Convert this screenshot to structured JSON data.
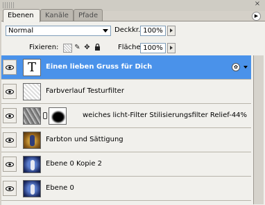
{
  "tabs": [
    {
      "label": "Ebenen",
      "active": true
    },
    {
      "label": "Kanäle",
      "active": false
    },
    {
      "label": "Pfade",
      "active": false
    }
  ],
  "blend_mode": {
    "selected": "Normal"
  },
  "opacity": {
    "label": "Deckkr.:",
    "value": "100%"
  },
  "fill": {
    "label": "Fläche:",
    "value": "100%"
  },
  "lock": {
    "label": "Fixieren:",
    "icons": [
      "lock-transparent-icon",
      "lock-image-icon",
      "lock-position-icon",
      "lock-all-icon"
    ]
  },
  "layers": [
    {
      "name": "Einen lieben Gruss für  Dich",
      "thumb": "text",
      "selected": true,
      "fx": true
    },
    {
      "name": "Farbverlauf Testurfilter",
      "thumb": "transparent",
      "selected": false
    },
    {
      "name": "weiches licht-Filter Stilisierungsfilter Relief-44%",
      "thumb": "relief",
      "mask": true,
      "selected": false
    },
    {
      "name": "Farbton und Sättigung",
      "thumb": "photo-gold",
      "selected": false
    },
    {
      "name": "Ebene 0 Kopie 2",
      "thumb": "photo-blue",
      "selected": false
    },
    {
      "name": "Ebene 0",
      "thumb": "photo-blue",
      "selected": false
    }
  ],
  "colors": {
    "selected": "#4a92ea",
    "panel": "#f1f0ec"
  }
}
